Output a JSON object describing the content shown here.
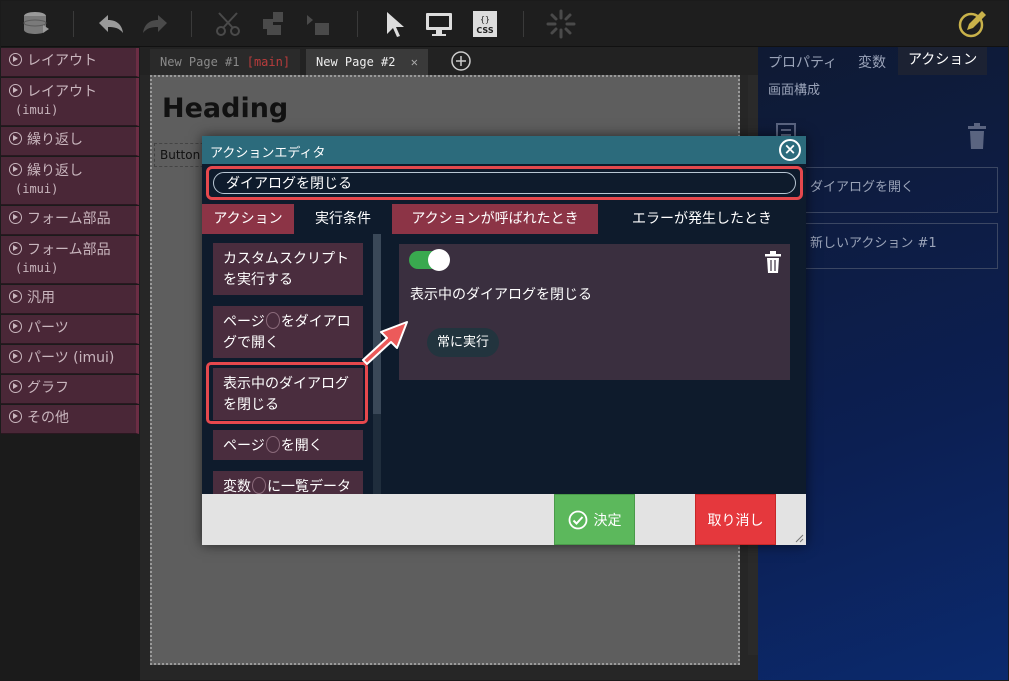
{
  "page_tabs": [
    {
      "label": "New Page #1",
      "tag": "[main]"
    },
    {
      "label": "New Page #2",
      "close": "✕"
    }
  ],
  "palette": [
    {
      "label": "レイアウト",
      "sub": ""
    },
    {
      "label": "レイアウト",
      "sub": "(imui)"
    },
    {
      "label": "繰り返し",
      "sub": ""
    },
    {
      "label": "繰り返し",
      "sub": "(imui)"
    },
    {
      "label": "フォーム部品",
      "sub": ""
    },
    {
      "label": "フォーム部品",
      "sub": "(imui)"
    },
    {
      "label": "汎用",
      "sub": ""
    },
    {
      "label": "パーツ",
      "sub": ""
    },
    {
      "label": "パーツ (imui)",
      "sub": ""
    },
    {
      "label": "グラフ",
      "sub": ""
    },
    {
      "label": "その他",
      "sub": ""
    }
  ],
  "canvas": {
    "heading": "Heading",
    "button": "Button"
  },
  "right_panel": {
    "tabs": [
      "プロパティ",
      "変数",
      "アクション"
    ],
    "subtab": "画面構成",
    "cards": [
      "ダイアログを開く",
      "新しいアクション #1"
    ]
  },
  "dialog": {
    "title": "アクションエディタ",
    "name_value": "ダイアログを閉じる",
    "tabs": [
      "アクション",
      "実行条件",
      "アクションが呼ばれたとき",
      "エラーが発生したとき"
    ],
    "actions": [
      {
        "line1": "カスタムスクリプト",
        "line2": "を実行する"
      },
      {
        "pre": "ページ",
        "post": "をダイアロ",
        "line2": "グで開く"
      },
      {
        "line1": "表示中のダイアログ",
        "line2": "を閉じる"
      },
      {
        "pre": "ページ",
        "post": "を開く"
      },
      {
        "pre": "変数",
        "post": "に一覧データ"
      }
    ],
    "card": {
      "title": "表示中のダイアログを閉じる",
      "chip": "常に実行"
    },
    "ok_label": "決定",
    "cancel_label": "取り消し"
  },
  "colors": {
    "accent_red": "#e5484d",
    "ok_green": "#5cb85c",
    "cancel_red": "#e5383d",
    "dialog_header": "#2c6b7c",
    "palette_bg": "#4a2737"
  }
}
